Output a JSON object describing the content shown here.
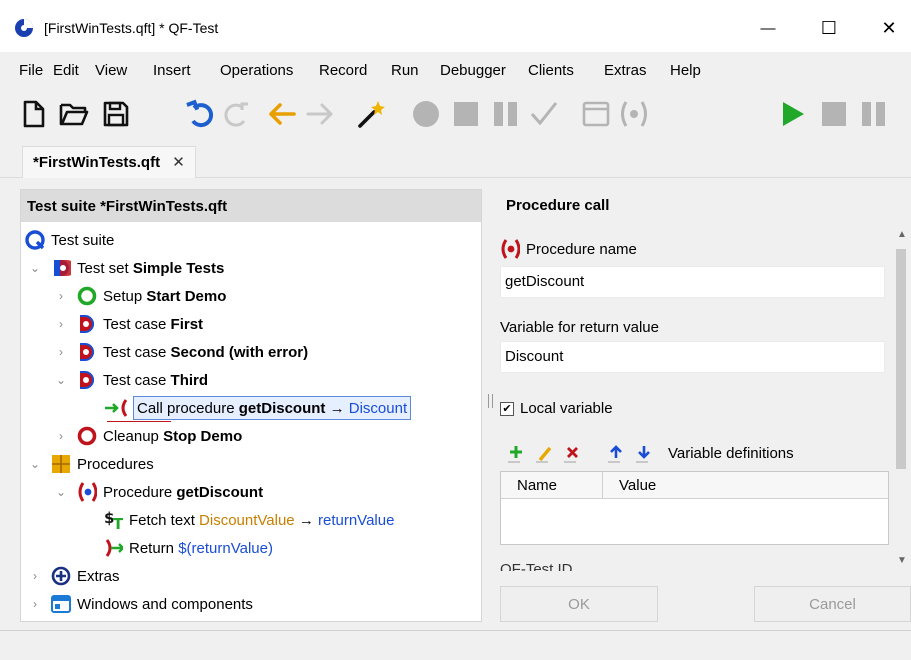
{
  "window": {
    "title": "[FirstWinTests.qft] * QF-Test",
    "minimize_glyph": "—",
    "maximize_glyph": "☐",
    "close_glyph": "✕"
  },
  "menu": [
    "File",
    "Edit",
    "View",
    "Insert",
    "Operations",
    "Record",
    "Run",
    "Debugger",
    "Clients",
    "Extras",
    "Help"
  ],
  "toolbar_icons": [
    "new-file-icon",
    "open-folder-icon",
    "save-icon",
    "undo-icon",
    "redo-icon",
    "back-arrow-icon",
    "forward-arrow-icon",
    "wizard-wand-icon",
    "record-icon",
    "stop-record-icon",
    "pause-record-icon",
    "check-icon",
    "window-icon",
    "procedure-record-icon",
    "play-icon",
    "stop-icon",
    "pause-icon"
  ],
  "tab": {
    "label": "*FirstWinTests.qft",
    "close": "✕"
  },
  "tree": {
    "header": "Test suite *FirstWinTests.qft",
    "nodes": [
      {
        "prefix": "Test suite",
        "name": ""
      },
      {
        "prefix": "Test set",
        "name": "Simple Tests"
      },
      {
        "prefix": "Setup",
        "name": "Start Demo"
      },
      {
        "prefix": "Test case",
        "name": "First"
      },
      {
        "prefix": "Test case",
        "name": "Second (with error)"
      },
      {
        "prefix": "Test case",
        "name": "Third"
      },
      {
        "prefix": "Call procedure",
        "name": "getDiscount",
        "arrow": "→",
        "target": "Discount"
      },
      {
        "prefix": "Cleanup",
        "name": "Stop Demo"
      },
      {
        "prefix": "Procedures",
        "name": ""
      },
      {
        "prefix": "Procedure",
        "name": "getDiscount"
      },
      {
        "prefix": "Fetch text",
        "name": "DiscountValue",
        "arrow": "→",
        "target": "returnValue"
      },
      {
        "prefix": "Return",
        "name": "$(returnValue)"
      },
      {
        "prefix": "Extras",
        "name": ""
      },
      {
        "prefix": "Windows and components",
        "name": ""
      }
    ]
  },
  "detail": {
    "title": "Procedure call",
    "procedure_name_label": "Procedure name",
    "procedure_name_value": "getDiscount",
    "return_var_label": "Variable for return value",
    "return_var_value": "Discount",
    "local_variable_label": "Local variable",
    "local_variable_checked": true,
    "variable_definitions_label": "Variable definitions",
    "table_headers": [
      "Name",
      "Value"
    ],
    "cut_label": "QF-Test ID",
    "ok_label": "OK",
    "cancel_label": "Cancel"
  },
  "colors": {
    "accent_blue": "#1a4dd6",
    "orange_text": "#c77f00",
    "play_green": "#22a828",
    "procedure_red": "#c0141c",
    "toolbar_gray": "#b4b4b4",
    "undo_blue": "#1e5fd0",
    "arrow_orange": "#e8a000"
  }
}
